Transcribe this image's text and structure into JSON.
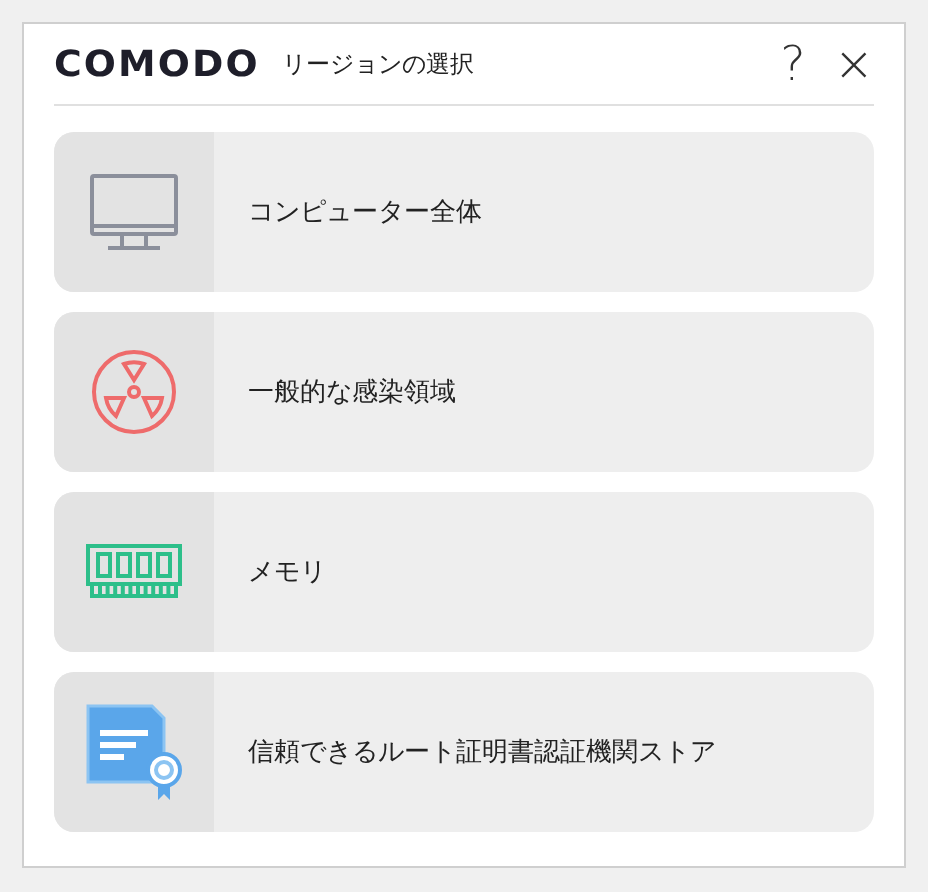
{
  "window": {
    "logo": "COMODO",
    "title": "リージョンの選択",
    "help": "?",
    "close": "×"
  },
  "options": [
    {
      "kind": "monitor",
      "label": "コンピューター全体"
    },
    {
      "kind": "radiation",
      "label": "一般的な感染領域"
    },
    {
      "kind": "memory",
      "label": "メモリ"
    },
    {
      "kind": "certificate",
      "label": "信頼できるルート証明書認証機関ストア"
    }
  ]
}
